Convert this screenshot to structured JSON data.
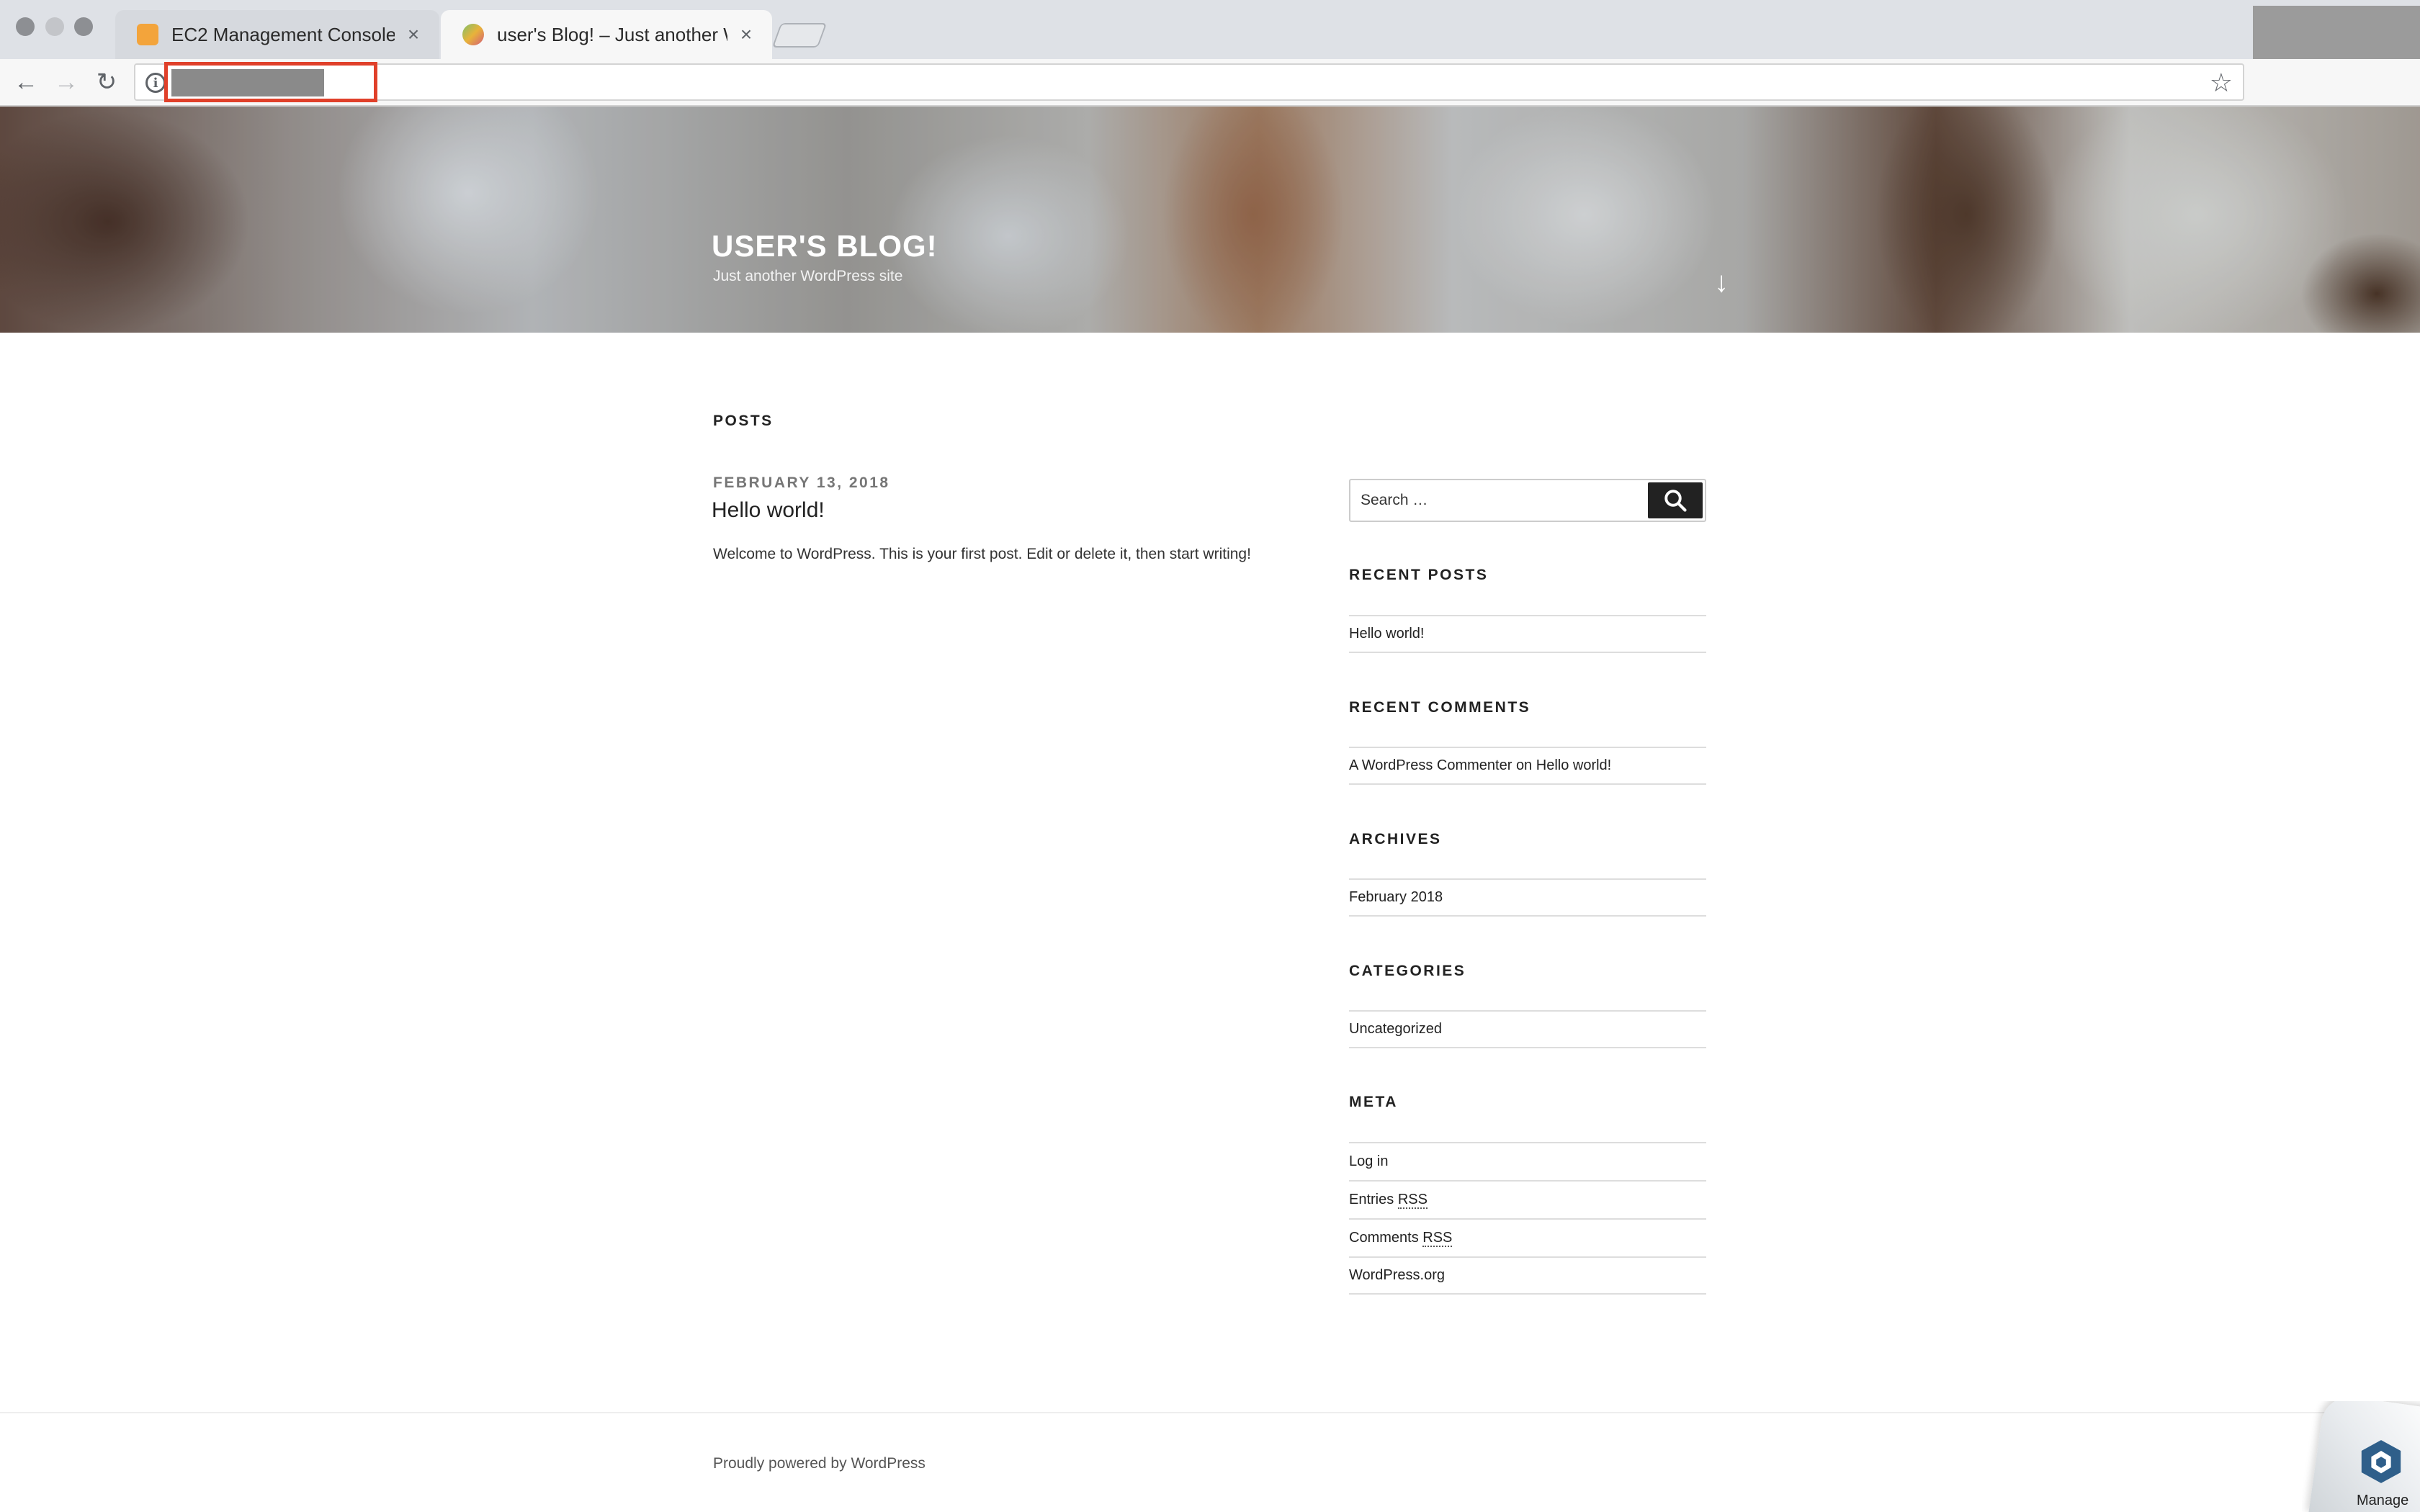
{
  "browser": {
    "tabs": [
      {
        "title": "EC2 Management Console",
        "favicon": "aws-box-icon",
        "active": false
      },
      {
        "title": "user's Blog! – Just another Wo",
        "favicon": "wordpress-favicon-icon",
        "active": true
      }
    ],
    "close_glyph": "×",
    "icons": {
      "back": "←",
      "forward": "→",
      "reload": "↻",
      "info": "i",
      "star": "☆"
    }
  },
  "site": {
    "title": "USER'S BLOG!",
    "description": "Just another WordPress site",
    "scroll_arrow": "↓"
  },
  "main": {
    "section_heading": "POSTS",
    "posts": [
      {
        "date": "FEBRUARY 13, 2018",
        "title": "Hello world!",
        "excerpt": "Welcome to WordPress. This is your first post. Edit or delete it, then start writing!"
      }
    ]
  },
  "sidebar": {
    "search": {
      "placeholder": "Search …"
    },
    "recent_posts": {
      "title": "RECENT POSTS",
      "items": [
        "Hello world!"
      ]
    },
    "recent_comments": {
      "title": "RECENT COMMENTS",
      "items": [
        {
          "author": "A WordPress Commenter",
          "on": "on",
          "post": "Hello world!"
        }
      ]
    },
    "archives": {
      "title": "ARCHIVES",
      "items": [
        "February 2018"
      ]
    },
    "categories": {
      "title": "CATEGORIES",
      "items": [
        "Uncategorized"
      ]
    },
    "meta": {
      "title": "META",
      "log_in": "Log in",
      "entries": "Entries",
      "comments": "Comments",
      "rss": "RSS",
      "wordpress_org": "WordPress.org"
    }
  },
  "footer": {
    "powered_by": "Proudly powered by WordPress"
  },
  "manage_badge": {
    "label": "Manage"
  },
  "colors": {
    "url_highlight": "#e0402a",
    "search_button": "#222222",
    "aws_orange": "#f3a43b"
  }
}
